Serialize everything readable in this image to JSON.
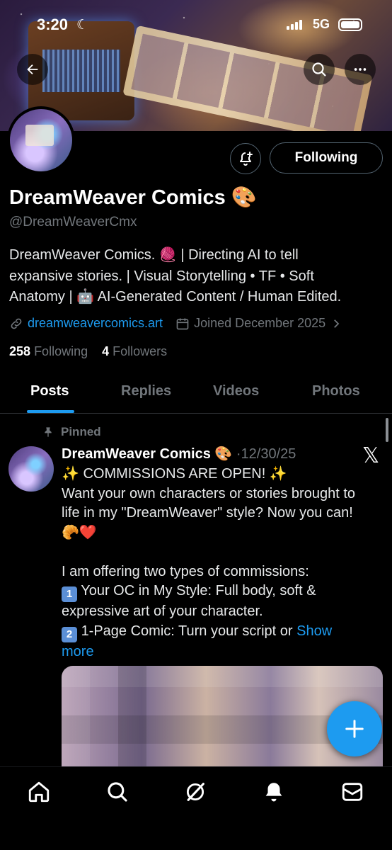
{
  "status_bar": {
    "time": "3:20",
    "network": "5G"
  },
  "profile": {
    "display_name": "DreamWeaver Comics 🎨",
    "handle": "@DreamWeaverCmx",
    "bio_lines": [
      "DreamWeaver Comics. 🧶 | Directing AI to tell",
      "expansive stories. | Visual Storytelling • TF • Soft",
      "Anatomy | 🤖 AI-Generated Content / Human Edited."
    ],
    "website": "dreamweavercomics.art",
    "joined": "Joined December 2025",
    "following_count": "258",
    "following_label": "Following",
    "followers_count": "4",
    "followers_label": "Followers",
    "follow_button": "Following"
  },
  "tabs": [
    {
      "label": "Posts",
      "active": true
    },
    {
      "label": "Replies",
      "active": false
    },
    {
      "label": "Videos",
      "active": false
    },
    {
      "label": "Photos",
      "active": false
    }
  ],
  "post": {
    "pinned_label": "Pinned",
    "author": "DreamWeaver Comics 🎨",
    "date": "·12/30/25",
    "lines": [
      "✨ COMMISSIONS ARE OPEN! ✨",
      "Want your own characters or stories brought to",
      "life in my \"DreamWeaver\" style? Now you can!",
      "🥐❤️",
      "I am offering two types of commissions:",
      "Your OC in My Style: Full body, soft &",
      "expressive art of your character.",
      "1-Page Comic: Turn your script or"
    ],
    "item_numbers": [
      "1",
      "2"
    ],
    "show_more_1": "Show",
    "show_more_2": "more"
  },
  "colors": {
    "accent": "#1d9bf0",
    "muted": "#71767b",
    "background": "#000000"
  },
  "icons": [
    "back-arrow-icon",
    "search-icon",
    "more-icon",
    "bell-plus-icon",
    "pin-icon",
    "link-icon",
    "calendar-icon",
    "chevron-right-icon",
    "x-logo-icon",
    "plus-icon",
    "home-icon",
    "grok-icon",
    "notifications-icon",
    "messages-icon"
  ]
}
